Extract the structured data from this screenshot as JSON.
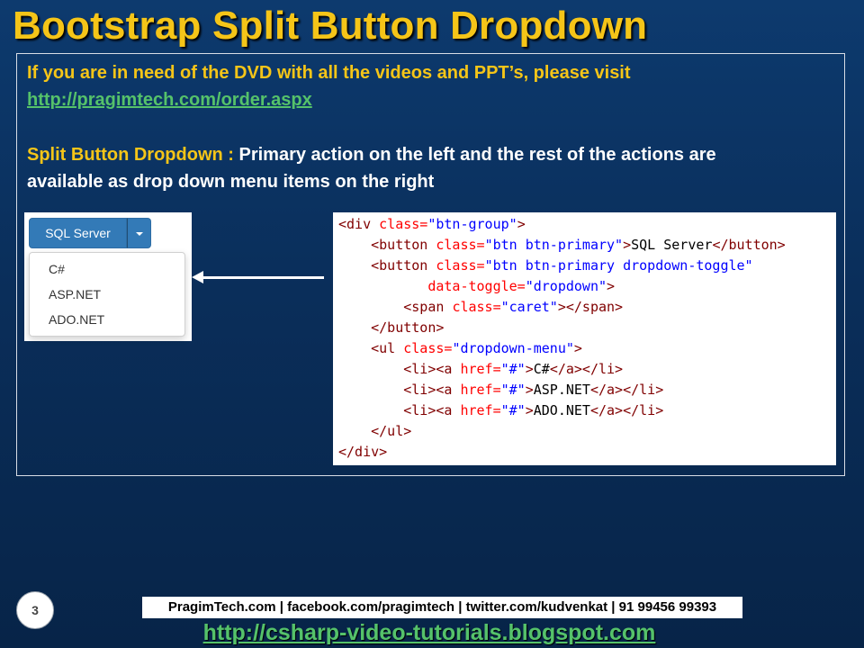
{
  "slide": {
    "title": "Bootstrap Split Button Dropdown",
    "page_number": "3"
  },
  "intro": {
    "line1": "If you are in need of the DVD with all the videos and PPT’s, please visit",
    "link": "http://pragimtech.com/order.aspx"
  },
  "description": {
    "label": "Split Button Dropdown : ",
    "text1": "Primary action on the left and the rest of the actions are",
    "text2": "available as drop down menu items on the right"
  },
  "demo": {
    "button_label": "SQL Server",
    "menu_items": [
      "C#",
      "ASP.NET",
      "ADO.NET"
    ]
  },
  "code": {
    "l1": {
      "t1": "<div ",
      "a1": "class=",
      "v1": "\"btn-group\"",
      "t2": ">"
    },
    "l2": {
      "t1": "<button ",
      "a1": "class=",
      "v1": "\"btn btn-primary\"",
      "t2": ">",
      "x": "SQL Server",
      "t3": "</button>"
    },
    "l3": {
      "t1": "<button ",
      "a1": "class=",
      "v1": "\"btn btn-primary dropdown-toggle\""
    },
    "l4": {
      "a1": "data-toggle=",
      "v1": "\"dropdown\"",
      "t1": ">"
    },
    "l5": {
      "t1": "<span ",
      "a1": "class=",
      "v1": "\"caret\"",
      "t2": "></span>"
    },
    "l6": {
      "t1": "</button>"
    },
    "l7": {
      "t1": "<ul ",
      "a1": "class=",
      "v1": "\"dropdown-menu\"",
      "t2": ">"
    },
    "l8": {
      "t1": "<li><a ",
      "a1": "href=",
      "v1": "\"#\"",
      "t2": ">",
      "x": "C#",
      "t3": "</a></li>"
    },
    "l9": {
      "t1": "<li><a ",
      "a1": "href=",
      "v1": "\"#\"",
      "t2": ">",
      "x": "ASP.NET",
      "t3": "</a></li>"
    },
    "l10": {
      "t1": "<li><a ",
      "a1": "href=",
      "v1": "\"#\"",
      "t2": ">",
      "x": "ADO.NET",
      "t3": "</a></li>"
    },
    "l11": {
      "t1": "</ul>"
    },
    "l12": {
      "t1": "</div>"
    }
  },
  "footer": {
    "contact": "PragimTech.com | facebook.com/pragimtech  | twitter.com/kudvenkat  | 91 99456 99393",
    "blog_link": "http://csharp-video-tutorials.blogspot.com"
  },
  "colors": {
    "title": "#f5c518",
    "link": "#55c26a",
    "background": "#0a2e5a",
    "bootstrap_primary": "#337ab7"
  }
}
